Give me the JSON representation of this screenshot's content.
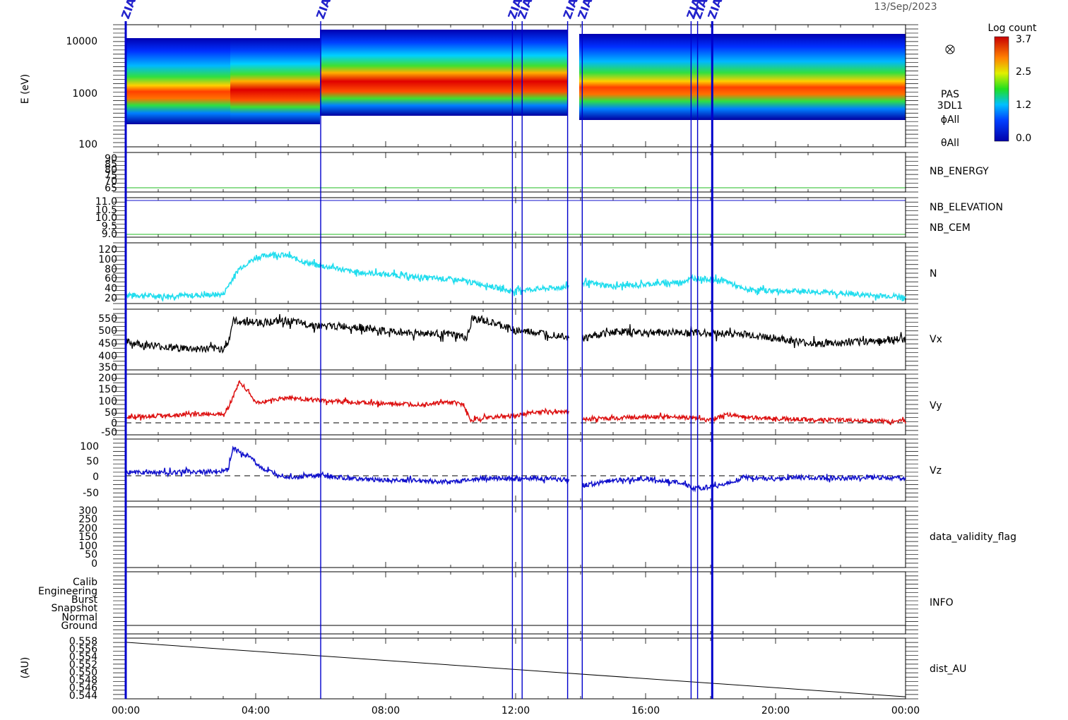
{
  "date": "13/Sep/2023",
  "colorbar": {
    "title": "Log count",
    "ticks": [
      "3.7",
      "2.5",
      "1.2",
      "0.0"
    ]
  },
  "x_ticks": [
    "00:00",
    "04:00",
    "08:00",
    "12:00",
    "16:00",
    "20:00",
    "00:00"
  ],
  "event_labels": [
    "ZIAS",
    "ZIAS",
    "ZIAS",
    "ZIAS",
    "ZIAS",
    "ZIAS",
    "ZIAS",
    "ZIAS",
    "ZIAS"
  ],
  "panels": {
    "spectrogram": {
      "ylabel": "E (eV)",
      "ticks": [
        "10000",
        "1000",
        "100"
      ],
      "side_labels": [
        "PAS",
        "3DL1",
        "ϕAll",
        "θAll"
      ]
    },
    "nb": {
      "ticks": [
        "90",
        "85",
        "80",
        "75",
        "70",
        "65"
      ],
      "label": "NB_ENERGY"
    },
    "elev": {
      "ticks": [
        "11.0",
        "10.5",
        "10.0",
        "9.5",
        "9.0"
      ],
      "labels": [
        "NB_ELEVATION",
        "NB_CEM"
      ]
    },
    "n": {
      "ticks": [
        "120",
        "100",
        "80",
        "60",
        "40",
        "20"
      ],
      "label": "N"
    },
    "vx": {
      "ticks": [
        "550",
        "500",
        "450",
        "400",
        "350"
      ],
      "label": "Vx"
    },
    "vy": {
      "ticks": [
        "200",
        "150",
        "100",
        "50",
        "0",
        "-50"
      ],
      "label": "Vy"
    },
    "vz": {
      "ticks": [
        "100",
        "50",
        "0",
        "-50"
      ],
      "label": "Vz"
    },
    "dvf": {
      "ticks": [
        "300",
        "250",
        "200",
        "150",
        "100",
        "50",
        "0"
      ],
      "label": "data_validity_flag"
    },
    "info": {
      "ticks": [
        "Calib",
        "Engineering",
        "Burst",
        "Snapshot",
        "Normal",
        "Ground"
      ],
      "label": "INFO"
    },
    "dist": {
      "ylabel": "(AU)",
      "ticks": [
        "0.558",
        "0.556",
        "0.554",
        "0.552",
        "0.550",
        "0.548",
        "0.546",
        "0.544"
      ],
      "label": "dist_AU"
    }
  },
  "colors": {
    "n": "#22ddee",
    "vx": "#000000",
    "vy": "#dd1111",
    "vz": "#1111cc",
    "marker": "#0000cc",
    "nb_line": "#22bb22"
  },
  "chart_data": {
    "type": "line",
    "x_unit": "hours (UT) on 13/Sep/2023",
    "xlim": [
      0,
      24
    ],
    "event_markers_hours": [
      0.0,
      6.0,
      11.9,
      12.2,
      13.6,
      14.05,
      17.4,
      17.6,
      18.05
    ],
    "data_gaps_hours": [
      [
        13.65,
        14.05
      ]
    ],
    "series": [
      {
        "name": "N",
        "x": [
          0,
          1,
          2,
          3,
          3.15,
          3.5,
          4,
          4.5,
          5,
          5.5,
          6,
          6.5,
          7,
          8,
          9,
          10,
          11,
          11.8,
          12.5,
          13.5,
          14.1,
          15,
          16,
          17,
          17.5,
          18,
          18.5,
          19,
          20,
          21,
          22,
          23,
          24
        ],
        "values": [
          27,
          25,
          26,
          28,
          45,
          80,
          100,
          108,
          104,
          92,
          84,
          80,
          72,
          68,
          62,
          58,
          48,
          35,
          38,
          42,
          52,
          44,
          48,
          52,
          60,
          58,
          54,
          38,
          35,
          34,
          30,
          26,
          24
        ],
        "ylim": [
          10,
          130
        ]
      },
      {
        "name": "Vx",
        "x": [
          0,
          1,
          2,
          3,
          3.15,
          3.3,
          4,
          5,
          6,
          7,
          8,
          9,
          10,
          10.5,
          10.7,
          11.5,
          12,
          13.5,
          14.1,
          15,
          16,
          17,
          18,
          19,
          20,
          21,
          22,
          23,
          24
        ],
        "values": [
          445,
          430,
          420,
          420,
          440,
          525,
          520,
          525,
          505,
          505,
          485,
          480,
          475,
          462,
          535,
          510,
          490,
          470,
          460,
          485,
          482,
          482,
          480,
          475,
          460,
          440,
          440,
          450,
          455
        ],
        "ylim": [
          340,
          570
        ]
      },
      {
        "name": "Vy",
        "x": [
          0,
          1,
          2,
          3,
          3.15,
          3.5,
          3.8,
          4,
          4.5,
          5,
          6,
          7,
          8,
          9,
          10,
          10.4,
          10.6,
          11,
          12,
          12.5,
          13.5,
          14.1,
          15,
          16,
          17,
          18,
          18.5,
          19,
          20,
          21,
          22,
          23,
          24
        ],
        "values": [
          20,
          25,
          30,
          35,
          60,
          175,
          130,
          80,
          95,
          105,
          92,
          85,
          78,
          75,
          85,
          75,
          5,
          15,
          25,
          40,
          45,
          10,
          15,
          20,
          20,
          5,
          30,
          20,
          12,
          8,
          5,
          3,
          0
        ],
        "ylim": [
          -60,
          210
        ]
      },
      {
        "name": "Vz",
        "x": [
          0,
          1,
          2,
          3,
          3.15,
          3.3,
          3.8,
          4.3,
          5,
          6,
          7,
          8,
          9,
          10,
          11,
          12,
          12.5,
          13.5,
          14.1,
          15,
          16,
          17,
          17.5,
          18,
          18.5,
          19,
          20,
          21,
          22,
          23,
          24
        ],
        "values": [
          10,
          10,
          12,
          15,
          20,
          85,
          60,
          15,
          -5,
          0,
          -10,
          -15,
          -15,
          -20,
          -8,
          -10,
          -8,
          -12,
          -30,
          -15,
          -10,
          -20,
          -40,
          -35,
          -25,
          -5,
          -10,
          -5,
          -8,
          -5,
          -8
        ],
        "ylim": [
          -80,
          115
        ]
      },
      {
        "name": "dist_AU",
        "x": [
          0,
          24
        ],
        "values": [
          0.5575,
          0.5443
        ],
        "ylim": [
          0.5438,
          0.5585
        ]
      }
    ],
    "energy_band_peak_eV": {
      "x": [
        0,
        3.15,
        3.3,
        6,
        9,
        12,
        14.1,
        18,
        24
      ],
      "values": [
        1100,
        1100,
        2000,
        1600,
        1400,
        1300,
        1300,
        1300,
        1150
      ]
    },
    "nb_energy_value": 66,
    "nb_elevation_value": 11.0,
    "nb_cem_value": 9.0
  }
}
